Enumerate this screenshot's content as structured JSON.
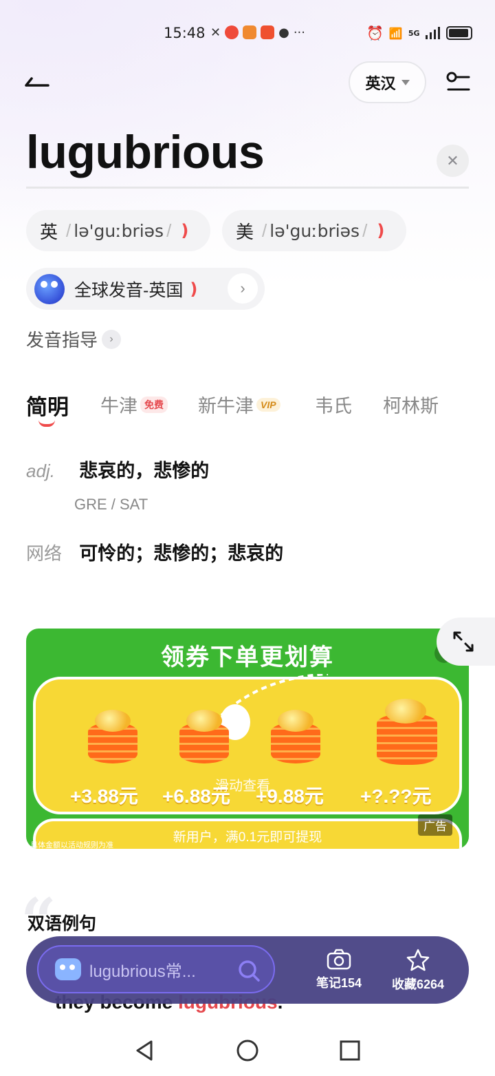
{
  "status": {
    "time": "15:48",
    "net": "5G"
  },
  "header": {
    "lang_label": "英汉"
  },
  "search": {
    "word": "lugubrious"
  },
  "pron": {
    "uk_region": "英",
    "uk_ipa": "lə'guːbriəs",
    "us_region": "美",
    "us_ipa": "lə'guːbriəs",
    "global_label": "全球发音-英国",
    "guide_label": "发音指导"
  },
  "tabs": [
    {
      "label": "简明"
    },
    {
      "label": "牛津",
      "badge": "免费"
    },
    {
      "label": "新牛津",
      "badge": "VIP"
    },
    {
      "label": "韦氏"
    },
    {
      "label": "柯林斯"
    }
  ],
  "definition": {
    "pos": "adj.",
    "meaning": "悲哀的，悲惨的",
    "tags": "GRE / SAT",
    "net_label": "网络",
    "net_meaning": "可怜的；悲惨的；悲哀的"
  },
  "ad": {
    "title": "领券下单更划算",
    "amounts": [
      "+3.88元",
      "+6.88元",
      "+9.88元",
      "+?.??元"
    ],
    "swipe_hint": "滑动查看",
    "subtitle": "新用户，满0.1元即可提现",
    "fine_print": "具体金额以活动规则为准",
    "label": "广告"
  },
  "examples": {
    "section_title": "双语例句",
    "sentence_before": "they become ",
    "highlight": "lugubrious",
    "sentence_after": "."
  },
  "bottom_bar": {
    "search_placeholder": "lugubrious常...",
    "notes_label": "笔记154",
    "favorites_label": "收藏6264"
  },
  "colors": {
    "accent": "#ef4a4a",
    "bottom_bar": "#484284",
    "ad_green": "#3cb832",
    "ad_yellow": "#f7d835"
  }
}
